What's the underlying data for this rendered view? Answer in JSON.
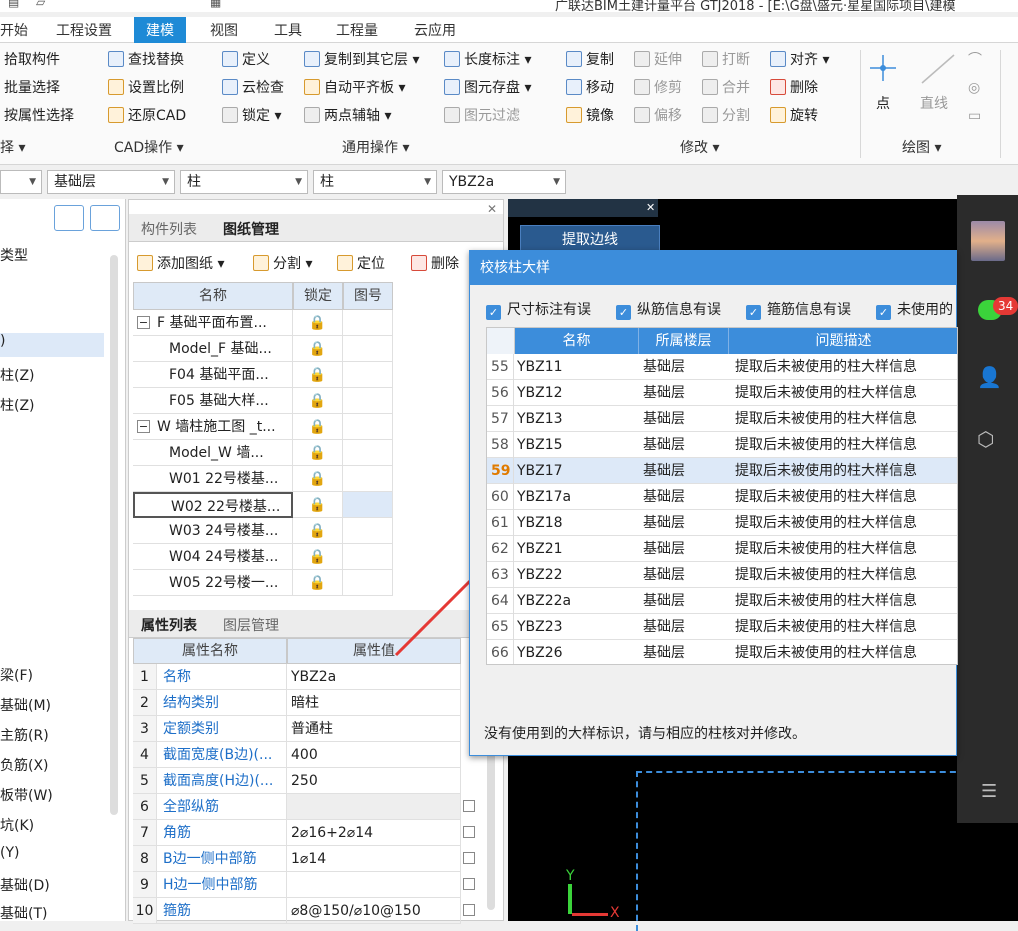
{
  "window": {
    "title": "广联达BIM土建计量平台 GTJ2018 - [E:\\G盘\\盛元·星星国际项目\\建模"
  },
  "menu": {
    "items": [
      "开始",
      "工程设置",
      "建模",
      "视图",
      "工具",
      "工程量",
      "云应用"
    ],
    "active": "建模"
  },
  "ribbon": {
    "col1": [
      "拾取构件",
      "批量选择",
      "按属性选择"
    ],
    "col2": [
      "查找替换",
      "设置比例",
      "还原CAD"
    ],
    "col3": [
      "定义",
      "云检查",
      "锁定 ▾"
    ],
    "col4": [
      "复制到其它层 ▾",
      "自动平齐板 ▾",
      "两点辅轴 ▾"
    ],
    "col5": [
      "长度标注 ▾",
      "图元存盘 ▾",
      "图元过滤"
    ],
    "col6": [
      "复制",
      "移动",
      "镜像"
    ],
    "col7": [
      "延伸",
      "修剪",
      "偏移"
    ],
    "col8": [
      "打断",
      "合并",
      "分割"
    ],
    "col9": [
      "对齐 ▾",
      "删除",
      "旋转"
    ],
    "draw": [
      "点",
      "直线"
    ],
    "groups": [
      "择 ▾",
      "CAD操作 ▾",
      "通用操作 ▾",
      "修改 ▾",
      "绘图 ▾"
    ]
  },
  "filters": [
    "",
    "基础层",
    "柱",
    "柱",
    "YBZ2a"
  ],
  "left_panel": {
    "items_top": [
      "类型",
      ")",
      "柱(Z)",
      "柱(Z)"
    ],
    "items_bottom": [
      "梁(F)",
      "基础(M)",
      "主筋(R)",
      "负筋(X)",
      "板带(W)",
      "坑(K)",
      "(Y)",
      "基础(D)",
      "基础(T)"
    ]
  },
  "mid_panel": {
    "tabs": [
      "构件列表",
      "图纸管理"
    ],
    "tools": [
      "添加图纸 ▾",
      "分割 ▾",
      "定位",
      "删除"
    ],
    "headers": [
      "名称",
      "锁定",
      "图号"
    ],
    "rows": [
      "F 基础平面布置...",
      "Model_F 基础...",
      "F04 基础平面...",
      "F05 基础大样...",
      "W 墙柱施工图 _t...",
      "Model_W 墙...",
      "W01 22号楼基...",
      "W02 22号楼基...",
      "W03 24号楼基...",
      "W04 24号楼基...",
      "W05 22号楼一..."
    ],
    "prop_tabs": [
      "属性列表",
      "图层管理"
    ],
    "prop_headers": [
      "属性名称",
      "属性值"
    ],
    "props": [
      {
        "n": "1",
        "name": "名称",
        "val": "YBZ2a"
      },
      {
        "n": "2",
        "name": "结构类别",
        "val": "暗柱"
      },
      {
        "n": "3",
        "name": "定额类别",
        "val": "普通柱"
      },
      {
        "n": "4",
        "name": "截面宽度(B边)(...",
        "val": "400"
      },
      {
        "n": "5",
        "name": "截面高度(H边)(...",
        "val": "250"
      },
      {
        "n": "6",
        "name": "全部纵筋",
        "val": ""
      },
      {
        "n": "7",
        "name": "角筋",
        "val": "2⌀16+2⌀14"
      },
      {
        "n": "8",
        "name": "B边一侧中部筋",
        "val": "1⌀14"
      },
      {
        "n": "9",
        "name": "H边一侧中部筋",
        "val": ""
      },
      {
        "n": "10",
        "name": "箍筋",
        "val": "⌀8@150/⌀10@150"
      }
    ]
  },
  "canvas": {
    "button": "提取边线",
    "axis_y": "Y",
    "axis_x": "X"
  },
  "dialog": {
    "title": "校核柱大样",
    "checks": [
      "尺寸标注有误",
      "纵筋信息有误",
      "箍筋信息有误",
      "未使用的"
    ],
    "headers": [
      "名称",
      "所属楼层",
      "问题描述"
    ],
    "rows": [
      {
        "n": "55",
        "name": "YBZ11",
        "floor": "基础层",
        "desc": "提取后未被使用的柱大样信息"
      },
      {
        "n": "56",
        "name": "YBZ12",
        "floor": "基础层",
        "desc": "提取后未被使用的柱大样信息"
      },
      {
        "n": "57",
        "name": "YBZ13",
        "floor": "基础层",
        "desc": "提取后未被使用的柱大样信息"
      },
      {
        "n": "58",
        "name": "YBZ15",
        "floor": "基础层",
        "desc": "提取后未被使用的柱大样信息"
      },
      {
        "n": "59",
        "name": "YBZ17",
        "floor": "基础层",
        "desc": "提取后未被使用的柱大样信息"
      },
      {
        "n": "60",
        "name": "YBZ17a",
        "floor": "基础层",
        "desc": "提取后未被使用的柱大样信息"
      },
      {
        "n": "61",
        "name": "YBZ18",
        "floor": "基础层",
        "desc": "提取后未被使用的柱大样信息"
      },
      {
        "n": "62",
        "name": "YBZ21",
        "floor": "基础层",
        "desc": "提取后未被使用的柱大样信息"
      },
      {
        "n": "63",
        "name": "YBZ22",
        "floor": "基础层",
        "desc": "提取后未被使用的柱大样信息"
      },
      {
        "n": "64",
        "name": "YBZ22a",
        "floor": "基础层",
        "desc": "提取后未被使用的柱大样信息"
      },
      {
        "n": "65",
        "name": "YBZ23",
        "floor": "基础层",
        "desc": "提取后未被使用的柱大样信息"
      },
      {
        "n": "66",
        "name": "YBZ26",
        "floor": "基础层",
        "desc": "提取后未被使用的柱大样信息"
      }
    ],
    "selected_row": "59",
    "footer": "没有使用到的大样标识，请与相应的柱核对并修改。"
  },
  "sidebar": {
    "badge": "34"
  },
  "colors": {
    "accent": "#3c8ddb",
    "arrow": "#e53935"
  }
}
